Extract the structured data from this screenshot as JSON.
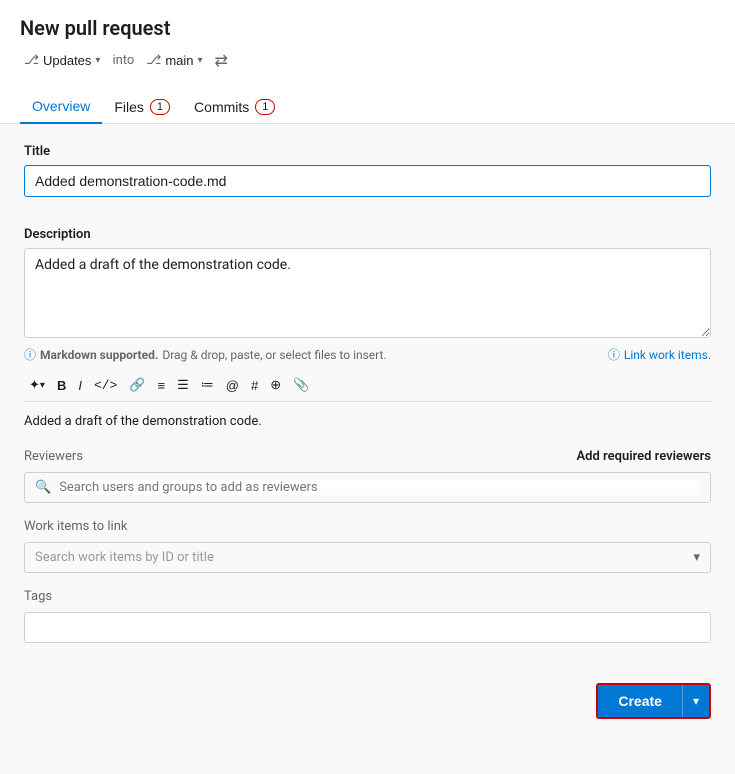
{
  "page": {
    "title": "New pull request"
  },
  "branch_row": {
    "updates_label": "Updates",
    "into_label": "into",
    "main_label": "main"
  },
  "tabs": [
    {
      "id": "overview",
      "label": "Overview",
      "badge": null,
      "active": true
    },
    {
      "id": "files",
      "label": "Files",
      "badge": "1",
      "active": false
    },
    {
      "id": "commits",
      "label": "Commits",
      "badge": "1",
      "active": false
    }
  ],
  "form": {
    "title_label": "Title",
    "title_value": "Added demonstration-code.md",
    "description_label": "Description",
    "description_value": "Added a draft of the demonstration code.",
    "markdown_note": "Markdown supported.",
    "drag_note": "Drag & drop, paste, or select files to insert.",
    "link_work_items": "Link work items.",
    "preview_text": "Added a draft of the demonstration code.",
    "reviewers_label": "Reviewers",
    "add_reviewers_label": "Add required reviewers",
    "reviewers_placeholder": "Search users and groups to add as reviewers",
    "work_items_label": "Work items to link",
    "work_items_placeholder": "Search work items by ID or title",
    "tags_label": "Tags",
    "tags_value": "",
    "create_label": "Create"
  },
  "toolbar": {
    "items": [
      {
        "name": "bold",
        "display": "B"
      },
      {
        "name": "italic",
        "display": "I"
      },
      {
        "name": "code",
        "display": "</>"
      },
      {
        "name": "link",
        "display": "🔗"
      },
      {
        "name": "ordered-list",
        "display": "≡"
      },
      {
        "name": "unordered-list",
        "display": "☰"
      },
      {
        "name": "task-list",
        "display": "✓"
      },
      {
        "name": "mention",
        "display": "@"
      },
      {
        "name": "heading",
        "display": "#"
      },
      {
        "name": "pull-request",
        "display": "⊕"
      },
      {
        "name": "attachment",
        "display": "📎"
      }
    ]
  }
}
